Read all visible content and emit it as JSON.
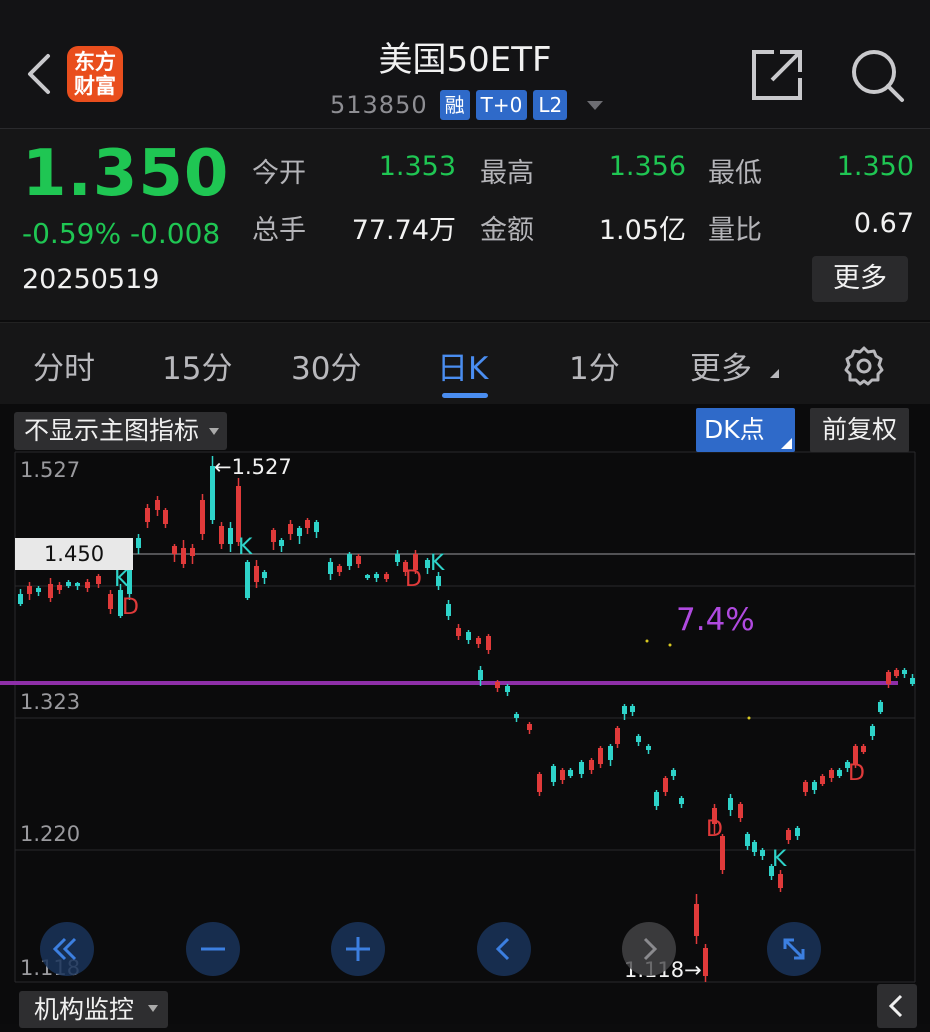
{
  "header": {
    "title": "美国50ETF",
    "code": "513850",
    "tags": [
      "融",
      "T+0",
      "L2"
    ],
    "logo_text": [
      "东方",
      "财富"
    ]
  },
  "quote": {
    "price": "1.350",
    "change_pct": "-0.59%",
    "change_abs": "-0.008",
    "date": "20250519",
    "more_label": "更多",
    "fields": [
      {
        "label": "今开",
        "value": "1.353",
        "color": "#1fc653"
      },
      {
        "label": "最高",
        "value": "1.356",
        "color": "#1fc653"
      },
      {
        "label": "最低",
        "value": "1.350",
        "color": "#1fc653"
      },
      {
        "label": "总手",
        "value": "77.74万",
        "color": "#f2f2f2"
      },
      {
        "label": "金额",
        "value": "1.05亿",
        "color": "#f2f2f2"
      },
      {
        "label": "量比",
        "value": "0.67",
        "color": "#f2f2f2"
      }
    ]
  },
  "tabs": [
    "分时",
    "15分",
    "30分",
    "日K",
    "1分",
    "更多"
  ],
  "active_tab": "日K",
  "chart_toolbar": {
    "indicator_select": "不显示主图指标",
    "dk_button": "DK点",
    "adjust_button": "前复权"
  },
  "chart": {
    "y_labels": [
      "1.527",
      "1.323",
      "1.220",
      "1.118"
    ],
    "crosshair_value": "1.450",
    "high_marker": "1.527",
    "low_marker": "1.118",
    "pct_annotation": "7.4%",
    "up_color": "#e03a3a",
    "down_color": "#2ed3c9",
    "line_color": "#8e2fa8",
    "signals": [
      {
        "text": "K",
        "color": "#2ed3c9"
      },
      {
        "text": "D",
        "color": "#e03a3a"
      },
      {
        "text": "K",
        "color": "#2ed3c9"
      },
      {
        "text": "D",
        "color": "#e03a3a"
      },
      {
        "text": "K",
        "color": "#2ed3c9"
      },
      {
        "text": "D",
        "color": "#e03a3a"
      },
      {
        "text": "K",
        "color": "#2ed3c9"
      },
      {
        "text": "D",
        "color": "#e03a3a"
      }
    ]
  },
  "bottom": {
    "monitor_select": "机构监控"
  }
}
